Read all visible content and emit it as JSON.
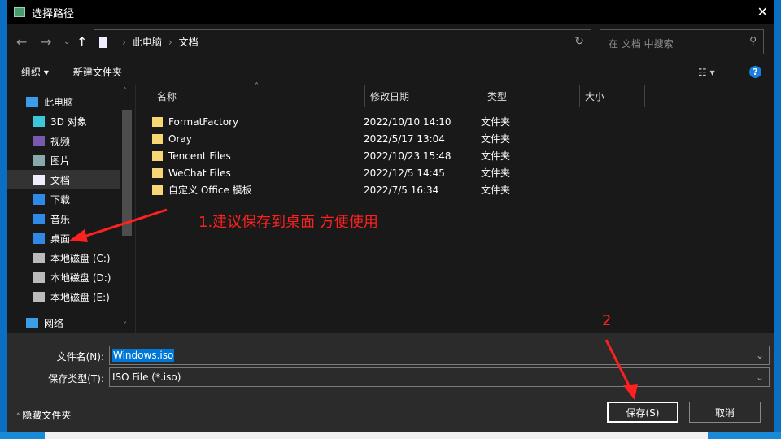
{
  "window": {
    "title": "选择路径"
  },
  "nav": {
    "path": [
      "此电脑",
      "文档"
    ],
    "search_placeholder": "在 文档 中搜索"
  },
  "toolbar": {
    "organize": "组织 ▾",
    "new_folder": "新建文件夹",
    "help": "?"
  },
  "sidebar": {
    "items": [
      {
        "label": "此电脑",
        "icon": "computer-icon",
        "color": "#3a9ee8"
      },
      {
        "label": "3D 对象",
        "icon": "cube-icon",
        "color": "#3cc8d8"
      },
      {
        "label": "视频",
        "icon": "film-icon",
        "color": "#7a5ab0"
      },
      {
        "label": "图片",
        "icon": "picture-icon",
        "color": "#8aa"
      },
      {
        "label": "文档",
        "icon": "document-icon",
        "color": "#eef"
      },
      {
        "label": "下载",
        "icon": "download-icon",
        "color": "#2e8ae6"
      },
      {
        "label": "音乐",
        "icon": "music-icon",
        "color": "#2e8ae6"
      },
      {
        "label": "桌面",
        "icon": "desktop-icon",
        "color": "#2e8ae6"
      },
      {
        "label": "本地磁盘 (C:)",
        "icon": "drive-icon",
        "color": "#bbb"
      },
      {
        "label": "本地磁盘 (D:)",
        "icon": "drive-icon",
        "color": "#bbb"
      },
      {
        "label": "本地磁盘 (E:)",
        "icon": "drive-icon",
        "color": "#bbb"
      },
      {
        "label": "网络",
        "icon": "network-icon",
        "color": "#3a9ee8"
      }
    ]
  },
  "columns": [
    "名称",
    "修改日期",
    "类型",
    "大小"
  ],
  "files": [
    {
      "name": "FormatFactory",
      "date": "2022/10/10 14:10",
      "type": "文件夹"
    },
    {
      "name": "Oray",
      "date": "2022/5/17 13:04",
      "type": "文件夹"
    },
    {
      "name": "Tencent Files",
      "date": "2022/10/23 15:48",
      "type": "文件夹"
    },
    {
      "name": "WeChat Files",
      "date": "2022/12/5 14:45",
      "type": "文件夹"
    },
    {
      "name": "自定义 Office 模板",
      "date": "2022/7/5 16:34",
      "type": "文件夹"
    }
  ],
  "form": {
    "filename_label": "文件名(N):",
    "filename": "Windows.iso",
    "type_label": "保存类型(T):",
    "type": "ISO File (*.iso)",
    "hide_folders": "隐藏文件夹",
    "save": "保存(S)",
    "cancel": "取消"
  },
  "annotations": {
    "step1": "1.建议保存到桌面 方便使用",
    "step2": "2"
  }
}
